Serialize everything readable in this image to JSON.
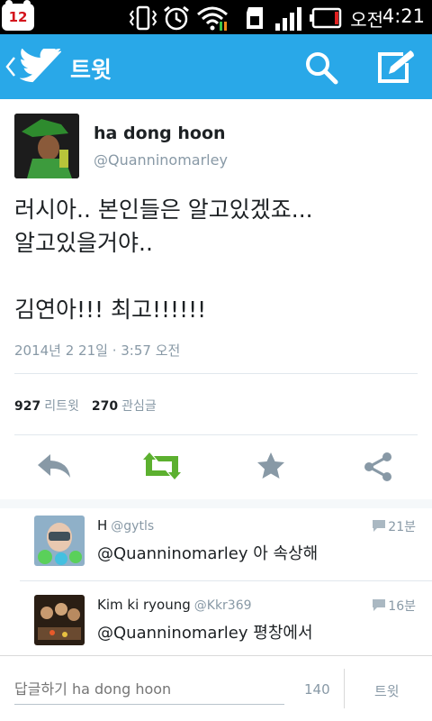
{
  "status_bar": {
    "notification_count": "12",
    "ampm": "오전",
    "time": "4:21",
    "icons": [
      "vibrate-icon",
      "alarm-icon",
      "wifi-icon",
      "sd-card-icon",
      "signal-icon",
      "battery-icon"
    ]
  },
  "action_bar": {
    "title": "트윗",
    "icons": [
      "back-chevron-icon",
      "twitter-bird-icon",
      "search-icon",
      "compose-icon"
    ],
    "color": "#29a8e8"
  },
  "tweet": {
    "author_name": "ha dong hoon",
    "author_handle": "@Quanninomarley",
    "text": "러시아.. 본인들은 알고있겠죠...\n알고있을거야..\n\n김연아!!! 최고!!!!!!",
    "date": "2014년 2 21일  ·  3:57 오전",
    "retweet_count": "927",
    "retweet_label": "리트윗",
    "favorite_count": "270",
    "favorite_label": "관심글",
    "retweet_active_color": "#5cb02f"
  },
  "replies": [
    {
      "name": "H",
      "handle": "@gytls",
      "time": "21분",
      "text": "@Quanninomarley 아 속상해"
    },
    {
      "name": "Kim ki ryoung",
      "handle": "@Kkr369",
      "time": "16분",
      "text": "@Quanninomarley 평창에서"
    }
  ],
  "composer": {
    "placeholder": "답글하기 ha dong hoon",
    "char_count": "140",
    "send_label": "트윗"
  }
}
